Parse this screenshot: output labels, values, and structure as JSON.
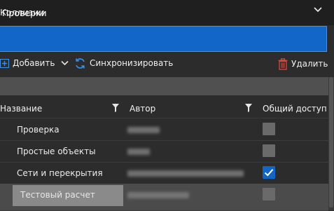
{
  "window": {
    "title": "Коллизии"
  },
  "header": {
    "title": "Проверки"
  },
  "toolbar": {
    "add_label": "Добавить",
    "sync_label": "Синхронизировать",
    "delete_label": "Удалить"
  },
  "table": {
    "columns": {
      "name": "Название",
      "author": "Автор",
      "shared": "Общий доступ"
    },
    "rows": [
      {
        "name": "Проверка",
        "shared": false
      },
      {
        "name": "Простые объекты",
        "shared": false
      },
      {
        "name": "Сети и перекрытия",
        "shared": true
      },
      {
        "name": "Тестовый расчет",
        "shared": false
      }
    ]
  },
  "colors": {
    "accent": "#1266c7",
    "delete": "#c0392b",
    "background": "#2c2c2c"
  },
  "icons": [
    "plus-icon",
    "chevron-down-icon",
    "sync-icon",
    "trash-icon",
    "filter-icon",
    "checkmark-icon"
  ]
}
